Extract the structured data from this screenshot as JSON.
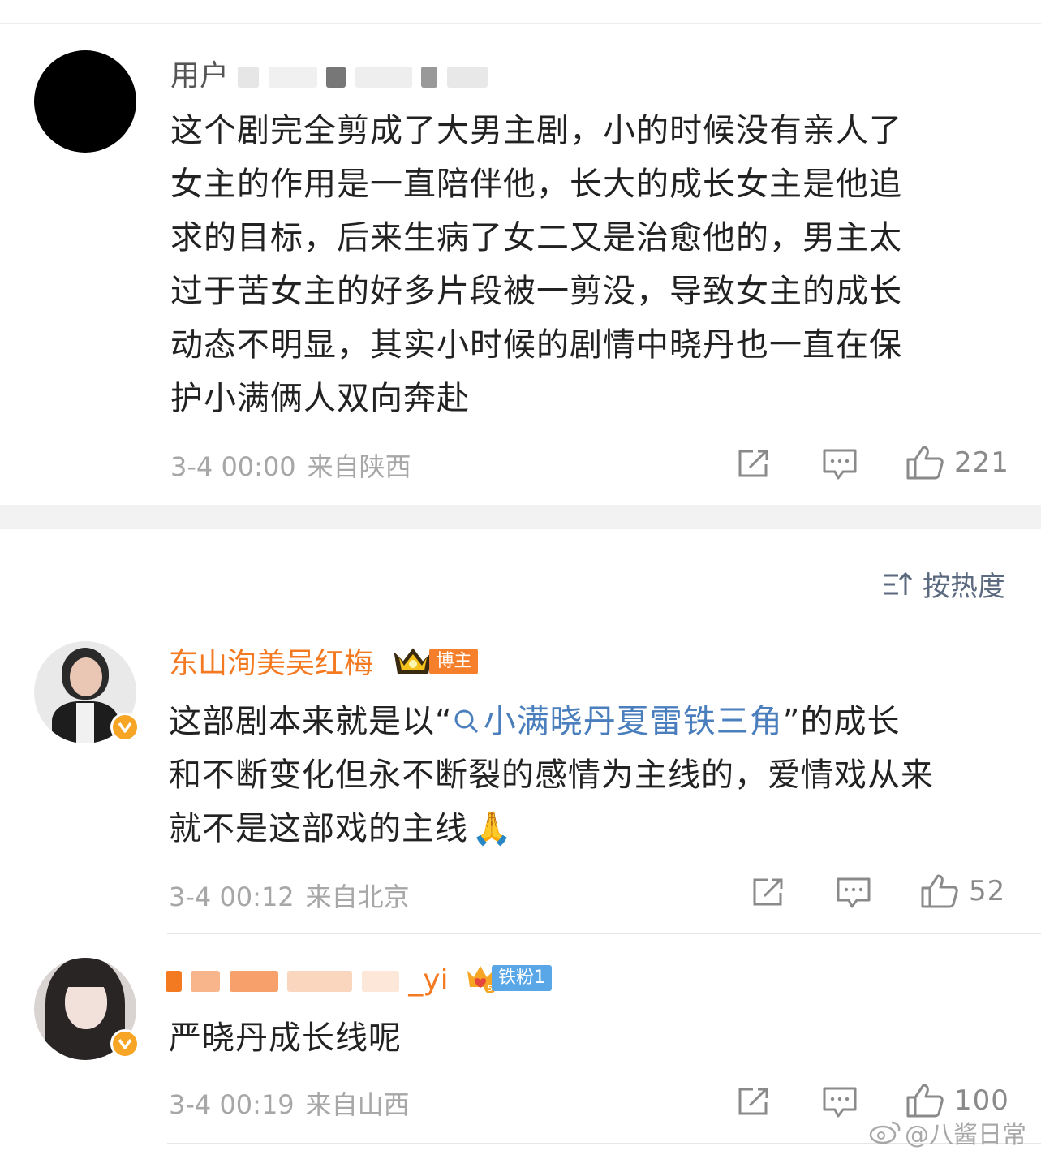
{
  "comments": [
    {
      "username": "用户",
      "text_lines": [
        "这个剧完全剪成了大男主剧，小的时候没有亲人了",
        "女主的作用是一直陪伴他，长大的成长女主是他追",
        "求的目标，后来生病了女二又是治愈他的，男主太",
        "过于苦女主的好多片段被一剪没，导致女主的成长",
        "动态不明显，其实小时候的剧情中晓丹也一直在保",
        "护小满俩人双向奔赴"
      ],
      "time": "3-4 00:00",
      "location": "来自陕西",
      "likes": "221"
    },
    {
      "username": "东山洵美吴红梅",
      "badge": "博主",
      "text_pre": "这部剧本来就是以“",
      "hashtag": "小满晓丹夏雷铁三角",
      "text_post": "”的成长",
      "text_lines": [
        "和不断变化但永不断裂的感情为主线的，爱情戏从来",
        "就不是这部戏的主线"
      ],
      "emoji": "🙏",
      "time": "3-4 00:12",
      "location": "来自北京",
      "likes": "52"
    },
    {
      "username_suffix": "_yi",
      "badge": "铁粉1",
      "text_lines": [
        "严晓丹成长线呢"
      ],
      "time": "3-4 00:19",
      "location": "来自山西",
      "likes": "100"
    }
  ],
  "sort": {
    "label": "按热度"
  },
  "watermark": "@八酱日常",
  "icons": [
    "share-icon",
    "comment-icon",
    "like-icon",
    "sort-icon",
    "verified-icon",
    "crown-icon",
    "weibo-logo-icon"
  ],
  "colors": {
    "username": "#f47a22",
    "hashtag": "#4a7ebc",
    "meta": "#a7a7a7",
    "verified": "#f6a524"
  }
}
